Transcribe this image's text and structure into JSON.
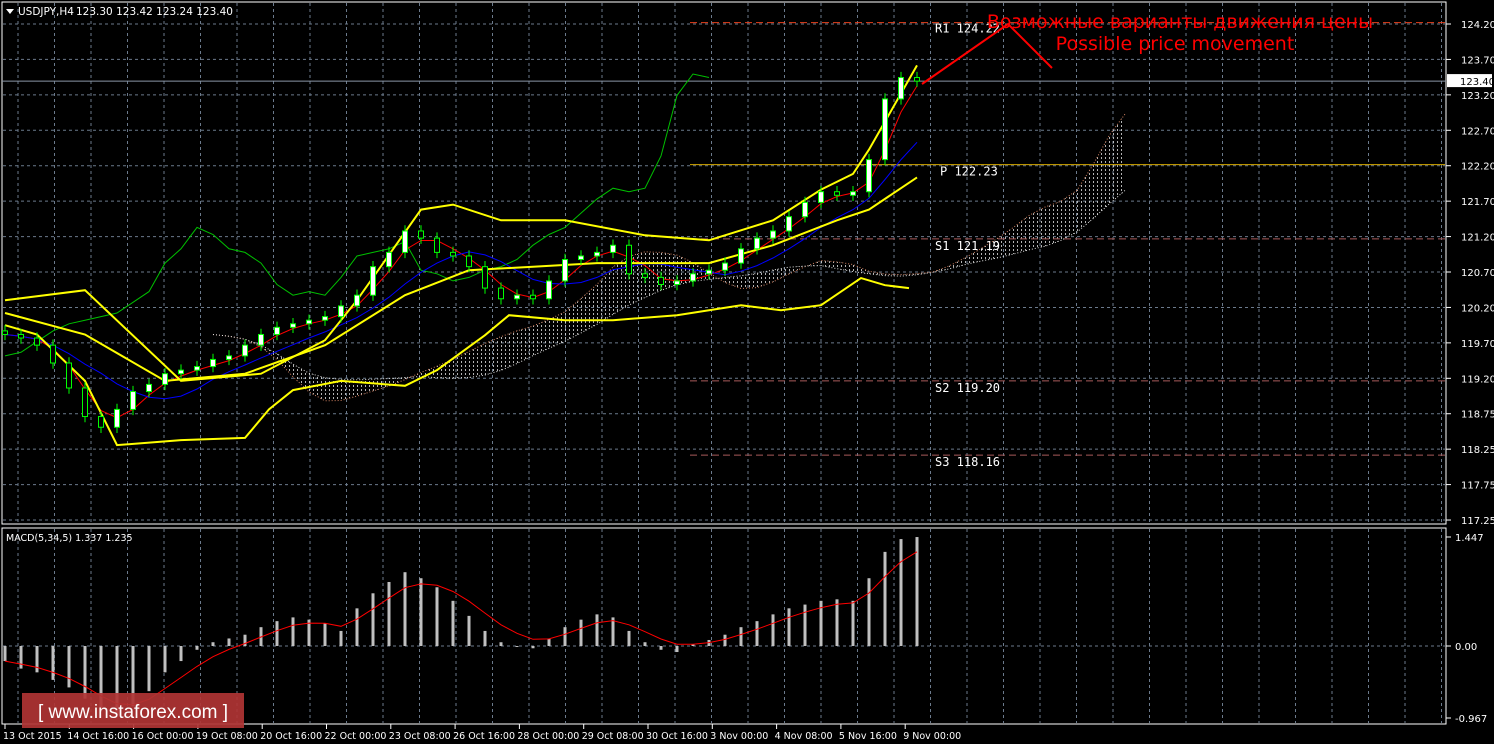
{
  "header": {
    "symbol": "USDJPY,H4",
    "ohlc": "123.30 123.42 123.24 123.40"
  },
  "macd_header": "MACD(5,34,5) 1.337 1.235",
  "current_price_label": "123.40",
  "watermark": "[ www.instaforex.com ]",
  "annotation": {
    "line1": "Возможные варианты движения цены",
    "line2": "Possible price movement"
  },
  "pivots": [
    {
      "label": "R1 124.22",
      "value": 124.22,
      "color": "#e8401c",
      "style": "dashed"
    },
    {
      "label": "P 122.23",
      "value": 122.23,
      "color": "#d4a800",
      "style": "solid"
    },
    {
      "label": "S1 121.19",
      "value": 121.19,
      "color": "#a85a5a",
      "style": "dashed"
    },
    {
      "label": "S2 119.20",
      "value": 119.2,
      "color": "#a85a5a",
      "style": "dashed"
    },
    {
      "label": "S3 118.16",
      "value": 118.16,
      "color": "#a85a5a",
      "style": "dashed"
    }
  ],
  "colors": {
    "grid": "#6b7a8c",
    "candle": "#00ff00",
    "bollinger": "#ffff00",
    "tenkan": "#ff0000",
    "kijun": "#0000ff",
    "chikou": "#00c000",
    "macd_hist": "#c0c0c0",
    "macd_signal": "#ff0000",
    "watermark_bg": "#b03434"
  },
  "chart_data": [
    {
      "type": "candlestick",
      "title": "USDJPY,H4",
      "ylim": [
        117.25,
        124.2
      ],
      "y_ticks": [
        "124.20",
        "123.70",
        "123.20",
        "122.70",
        "122.20",
        "121.70",
        "121.20",
        "120.70",
        "120.20",
        "119.70",
        "119.20",
        "118.75",
        "118.25",
        "117.75",
        "117.25"
      ],
      "x_ticks": [
        "13 Oct 2015",
        "14 Oct 16:00",
        "16 Oct 00:00",
        "19 Oct 08:00",
        "20 Oct 16:00",
        "22 Oct 00:00",
        "23 Oct 08:00",
        "26 Oct 16:00",
        "28 Oct 00:00",
        "29 Oct 08:00",
        "30 Oct 16:00",
        "3 Nov 00:00",
        "4 Nov 08:00",
        "5 Nov 16:00",
        "9 Nov 00:00"
      ],
      "closes": [
        119.85,
        119.8,
        119.7,
        119.45,
        119.1,
        118.7,
        118.55,
        118.8,
        119.05,
        119.15,
        119.3,
        119.35,
        119.4,
        119.5,
        119.55,
        119.7,
        119.85,
        119.95,
        120.0,
        120.05,
        120.1,
        120.25,
        120.4,
        120.8,
        121.0,
        121.3,
        121.2,
        121.0,
        120.95,
        120.8,
        120.5,
        120.35,
        120.4,
        120.35,
        120.6,
        120.9,
        120.95,
        121.0,
        121.1,
        120.7,
        120.65,
        120.55,
        120.6,
        120.7,
        120.75,
        120.85,
        121.05,
        121.2,
        121.3,
        121.5,
        121.7,
        121.85,
        121.8,
        121.85,
        122.3,
        123.15,
        123.45,
        123.4
      ],
      "bollinger_upper": [
        [
          0,
          120.33
        ],
        [
          5,
          120.47
        ],
        [
          11,
          119.2
        ],
        [
          16,
          119.3
        ],
        [
          20,
          119.77
        ],
        [
          22,
          120.33
        ],
        [
          26,
          121.6
        ],
        [
          28,
          121.67
        ],
        [
          31,
          121.45
        ],
        [
          35,
          121.45
        ],
        [
          40,
          121.24
        ],
        [
          44,
          121.17
        ],
        [
          48,
          121.45
        ],
        [
          51,
          121.88
        ],
        [
          53,
          122.1
        ],
        [
          54,
          122.44
        ],
        [
          57,
          123.62
        ]
      ],
      "bollinger_middle": [
        [
          0,
          120.15
        ],
        [
          5,
          119.85
        ],
        [
          10,
          119.2
        ],
        [
          15,
          119.3
        ],
        [
          20,
          119.7
        ],
        [
          25,
          120.4
        ],
        [
          29,
          120.75
        ],
        [
          33,
          120.8
        ],
        [
          37,
          120.85
        ],
        [
          44,
          120.85
        ],
        [
          48,
          121.1
        ],
        [
          52,
          121.45
        ],
        [
          54,
          121.6
        ],
        [
          57,
          122.05
        ]
      ],
      "bollinger_lower": [
        [
          0,
          119.98
        ],
        [
          2,
          119.85
        ],
        [
          5,
          119.2
        ],
        [
          7,
          118.3
        ],
        [
          11,
          118.37
        ],
        [
          15,
          118.4
        ],
        [
          16.5,
          118.8
        ],
        [
          18,
          119.07
        ],
        [
          21,
          119.2
        ],
        [
          25,
          119.13
        ],
        [
          27,
          119.35
        ],
        [
          30,
          119.84
        ],
        [
          31.5,
          120.12
        ],
        [
          35,
          120.05
        ],
        [
          38,
          120.05
        ],
        [
          42,
          120.12
        ],
        [
          46,
          120.26
        ],
        [
          48.5,
          120.19
        ],
        [
          51,
          120.26
        ],
        [
          53.5,
          120.64
        ],
        [
          55,
          120.54
        ],
        [
          56.5,
          120.5
        ]
      ]
    },
    {
      "type": "bar",
      "title": "MACD(5,34,5)",
      "ylim": [
        -0.967,
        1.447
      ],
      "y_ticks": [
        "1.447",
        "0.00",
        "-0.967"
      ],
      "histogram": [
        -0.2,
        -0.3,
        -0.35,
        -0.45,
        -0.55,
        -0.7,
        -0.85,
        -0.92,
        -0.8,
        -0.6,
        -0.35,
        -0.2,
        -0.05,
        0.05,
        0.1,
        0.15,
        0.25,
        0.33,
        0.38,
        0.35,
        0.3,
        0.2,
        0.5,
        0.7,
        0.85,
        0.98,
        0.9,
        0.78,
        0.6,
        0.4,
        0.2,
        0.05,
        0.0,
        -0.03,
        0.1,
        0.25,
        0.35,
        0.42,
        0.38,
        0.2,
        0.05,
        -0.05,
        -0.08,
        0.02,
        0.08,
        0.15,
        0.25,
        0.33,
        0.42,
        0.5,
        0.55,
        0.6,
        0.62,
        0.6,
        0.9,
        1.25,
        1.42,
        1.447
      ]
    }
  ]
}
